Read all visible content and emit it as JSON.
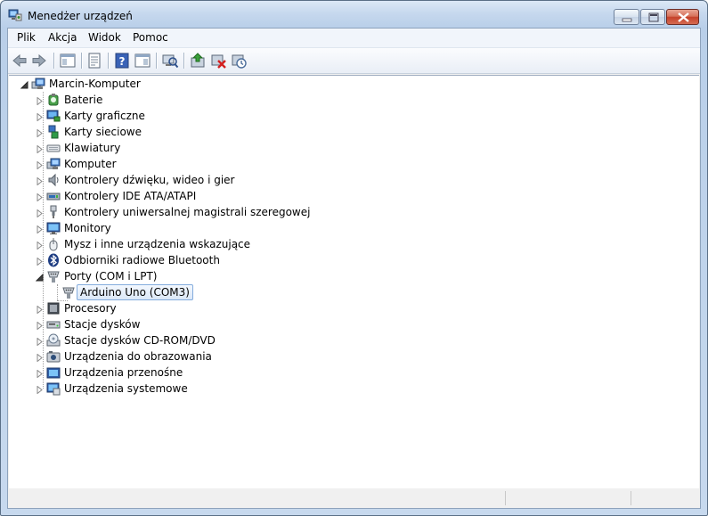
{
  "window": {
    "title": "Menedżer urządzeń",
    "accent": "#b9cfe9",
    "close_color": "#c5412a"
  },
  "menu": [
    {
      "id": "plik",
      "label": "Plik"
    },
    {
      "id": "akcja",
      "label": "Akcja"
    },
    {
      "id": "widok",
      "label": "Widok"
    },
    {
      "id": "pomoc",
      "label": "Pomoc"
    }
  ],
  "toolbar": [
    {
      "name": "back-icon"
    },
    {
      "name": "forward-icon"
    },
    {
      "name": "show-hide-console-tree-icon"
    },
    {
      "name": "properties-icon"
    },
    {
      "name": "help-icon"
    },
    {
      "name": "show-hide-action-pane-icon"
    },
    {
      "name": "scan-hardware-changes-icon"
    },
    {
      "name": "update-driver-icon"
    },
    {
      "name": "uninstall-device-icon"
    },
    {
      "name": "disable-device-icon"
    }
  ],
  "tree": {
    "root": {
      "label": "Marcin-Komputer",
      "icon": "computer-icon"
    },
    "categories": [
      {
        "label": "Baterie",
        "icon": "battery-icon"
      },
      {
        "label": "Karty graficzne",
        "icon": "display-adapter-icon"
      },
      {
        "label": "Karty sieciowe",
        "icon": "network-adapter-icon"
      },
      {
        "label": "Klawiatury",
        "icon": "keyboard-icon"
      },
      {
        "label": "Komputer",
        "icon": "computer-icon"
      },
      {
        "label": "Kontrolery dźwięku, wideo i gier",
        "icon": "speaker-icon"
      },
      {
        "label": "Kontrolery IDE ATA/ATAPI",
        "icon": "ide-controller-icon"
      },
      {
        "label": "Kontrolery uniwersalnej magistrali szeregowej",
        "icon": "usb-plug-icon"
      },
      {
        "label": "Monitory",
        "icon": "monitor-icon"
      },
      {
        "label": "Mysz i inne urządzenia wskazujące",
        "icon": "mouse-icon"
      },
      {
        "label": "Odbiorniki radiowe Bluetooth",
        "icon": "bluetooth-icon"
      },
      {
        "label": "Porty (COM i LPT)",
        "icon": "port-icon",
        "expanded": true,
        "children": [
          {
            "label": "Arduino Uno (COM3)",
            "icon": "port-icon",
            "selected": true
          }
        ]
      },
      {
        "label": "Procesory",
        "icon": "processor-icon"
      },
      {
        "label": "Stacje dysków",
        "icon": "disk-drive-icon"
      },
      {
        "label": "Stacje dysków CD-ROM/DVD",
        "icon": "cdrom-icon"
      },
      {
        "label": "Urządzenia do obrazowania",
        "icon": "camera-icon"
      },
      {
        "label": "Urządzenia przenośne",
        "icon": "portable-device-icon"
      },
      {
        "label": "Urządzenia systemowe",
        "icon": "system-device-icon"
      }
    ]
  },
  "status": {
    "panes": [
      "",
      "",
      ""
    ]
  }
}
